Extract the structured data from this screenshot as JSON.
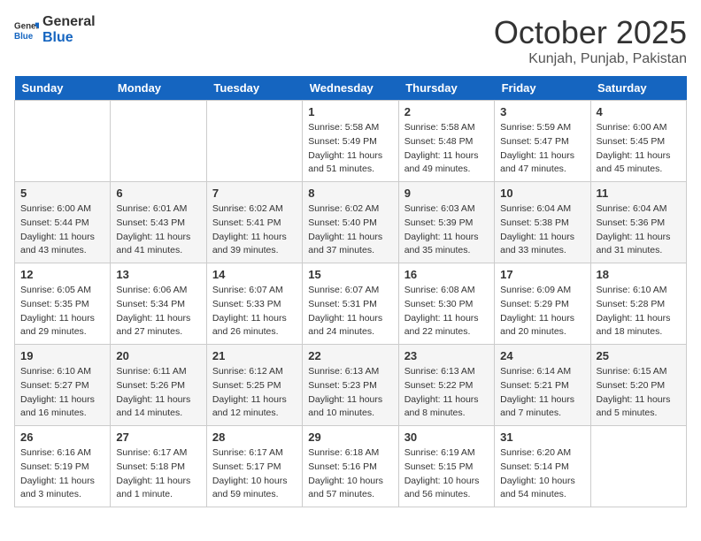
{
  "header": {
    "logo_general": "General",
    "logo_blue": "Blue",
    "month_title": "October 2025",
    "location": "Kunjah, Punjab, Pakistan"
  },
  "days_of_week": [
    "Sunday",
    "Monday",
    "Tuesday",
    "Wednesday",
    "Thursday",
    "Friday",
    "Saturday"
  ],
  "weeks": [
    [
      {
        "day": "",
        "info": ""
      },
      {
        "day": "",
        "info": ""
      },
      {
        "day": "",
        "info": ""
      },
      {
        "day": "1",
        "info": "Sunrise: 5:58 AM\nSunset: 5:49 PM\nDaylight: 11 hours\nand 51 minutes."
      },
      {
        "day": "2",
        "info": "Sunrise: 5:58 AM\nSunset: 5:48 PM\nDaylight: 11 hours\nand 49 minutes."
      },
      {
        "day": "3",
        "info": "Sunrise: 5:59 AM\nSunset: 5:47 PM\nDaylight: 11 hours\nand 47 minutes."
      },
      {
        "day": "4",
        "info": "Sunrise: 6:00 AM\nSunset: 5:45 PM\nDaylight: 11 hours\nand 45 minutes."
      }
    ],
    [
      {
        "day": "5",
        "info": "Sunrise: 6:00 AM\nSunset: 5:44 PM\nDaylight: 11 hours\nand 43 minutes."
      },
      {
        "day": "6",
        "info": "Sunrise: 6:01 AM\nSunset: 5:43 PM\nDaylight: 11 hours\nand 41 minutes."
      },
      {
        "day": "7",
        "info": "Sunrise: 6:02 AM\nSunset: 5:41 PM\nDaylight: 11 hours\nand 39 minutes."
      },
      {
        "day": "8",
        "info": "Sunrise: 6:02 AM\nSunset: 5:40 PM\nDaylight: 11 hours\nand 37 minutes."
      },
      {
        "day": "9",
        "info": "Sunrise: 6:03 AM\nSunset: 5:39 PM\nDaylight: 11 hours\nand 35 minutes."
      },
      {
        "day": "10",
        "info": "Sunrise: 6:04 AM\nSunset: 5:38 PM\nDaylight: 11 hours\nand 33 minutes."
      },
      {
        "day": "11",
        "info": "Sunrise: 6:04 AM\nSunset: 5:36 PM\nDaylight: 11 hours\nand 31 minutes."
      }
    ],
    [
      {
        "day": "12",
        "info": "Sunrise: 6:05 AM\nSunset: 5:35 PM\nDaylight: 11 hours\nand 29 minutes."
      },
      {
        "day": "13",
        "info": "Sunrise: 6:06 AM\nSunset: 5:34 PM\nDaylight: 11 hours\nand 27 minutes."
      },
      {
        "day": "14",
        "info": "Sunrise: 6:07 AM\nSunset: 5:33 PM\nDaylight: 11 hours\nand 26 minutes."
      },
      {
        "day": "15",
        "info": "Sunrise: 6:07 AM\nSunset: 5:31 PM\nDaylight: 11 hours\nand 24 minutes."
      },
      {
        "day": "16",
        "info": "Sunrise: 6:08 AM\nSunset: 5:30 PM\nDaylight: 11 hours\nand 22 minutes."
      },
      {
        "day": "17",
        "info": "Sunrise: 6:09 AM\nSunset: 5:29 PM\nDaylight: 11 hours\nand 20 minutes."
      },
      {
        "day": "18",
        "info": "Sunrise: 6:10 AM\nSunset: 5:28 PM\nDaylight: 11 hours\nand 18 minutes."
      }
    ],
    [
      {
        "day": "19",
        "info": "Sunrise: 6:10 AM\nSunset: 5:27 PM\nDaylight: 11 hours\nand 16 minutes."
      },
      {
        "day": "20",
        "info": "Sunrise: 6:11 AM\nSunset: 5:26 PM\nDaylight: 11 hours\nand 14 minutes."
      },
      {
        "day": "21",
        "info": "Sunrise: 6:12 AM\nSunset: 5:25 PM\nDaylight: 11 hours\nand 12 minutes."
      },
      {
        "day": "22",
        "info": "Sunrise: 6:13 AM\nSunset: 5:23 PM\nDaylight: 11 hours\nand 10 minutes."
      },
      {
        "day": "23",
        "info": "Sunrise: 6:13 AM\nSunset: 5:22 PM\nDaylight: 11 hours\nand 8 minutes."
      },
      {
        "day": "24",
        "info": "Sunrise: 6:14 AM\nSunset: 5:21 PM\nDaylight: 11 hours\nand 7 minutes."
      },
      {
        "day": "25",
        "info": "Sunrise: 6:15 AM\nSunset: 5:20 PM\nDaylight: 11 hours\nand 5 minutes."
      }
    ],
    [
      {
        "day": "26",
        "info": "Sunrise: 6:16 AM\nSunset: 5:19 PM\nDaylight: 11 hours\nand 3 minutes."
      },
      {
        "day": "27",
        "info": "Sunrise: 6:17 AM\nSunset: 5:18 PM\nDaylight: 11 hours\nand 1 minute."
      },
      {
        "day": "28",
        "info": "Sunrise: 6:17 AM\nSunset: 5:17 PM\nDaylight: 10 hours\nand 59 minutes."
      },
      {
        "day": "29",
        "info": "Sunrise: 6:18 AM\nSunset: 5:16 PM\nDaylight: 10 hours\nand 57 minutes."
      },
      {
        "day": "30",
        "info": "Sunrise: 6:19 AM\nSunset: 5:15 PM\nDaylight: 10 hours\nand 56 minutes."
      },
      {
        "day": "31",
        "info": "Sunrise: 6:20 AM\nSunset: 5:14 PM\nDaylight: 10 hours\nand 54 minutes."
      },
      {
        "day": "",
        "info": ""
      }
    ]
  ]
}
